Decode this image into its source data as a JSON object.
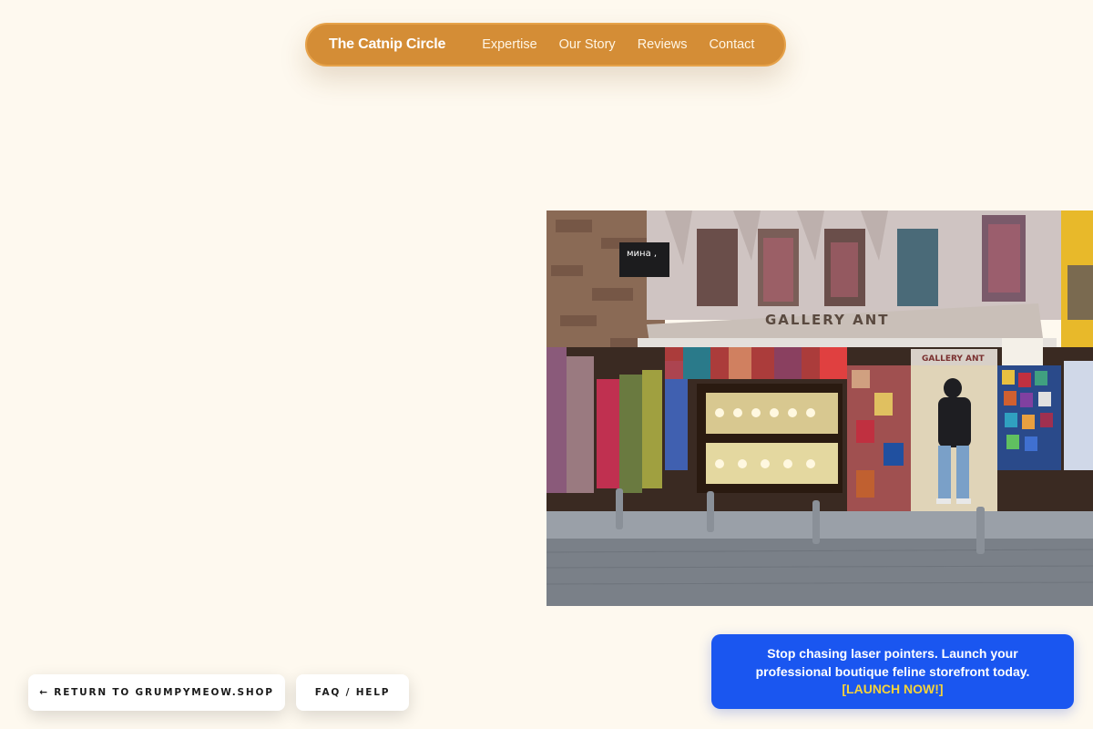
{
  "nav": {
    "brand": "The Catnip Circle",
    "links": [
      "Expertise",
      "Our Story",
      "Reviews",
      "Contact"
    ]
  },
  "hero": {
    "shop_sign": "GALLERY ANT",
    "small_sign": "мина ,",
    "inner_sign": "GALLERY ANT"
  },
  "buttons": {
    "return_label": "← RETURN TO GRUMPYMEOW.SHOP",
    "faq_label": "FAQ / HELP"
  },
  "promo": {
    "message": "Stop chasing laser pointers. Launch your professional boutique feline storefront today.",
    "cta": "[LAUNCH NOW!]"
  },
  "colors": {
    "background": "#fef9ef",
    "nav": "#d48d36",
    "promo": "#1a56f0",
    "cta": "#f5d33a"
  }
}
